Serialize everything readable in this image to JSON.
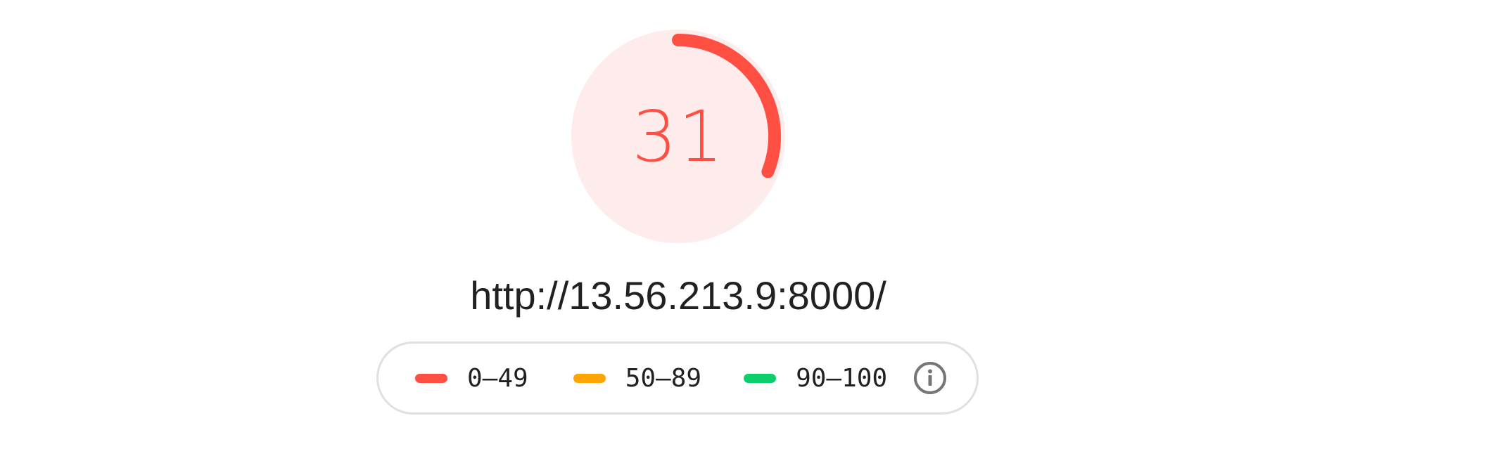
{
  "score": {
    "value": "31",
    "fraction": 0.31,
    "color": "#ff4e42",
    "track_color": "#fdeceb"
  },
  "url": "http://13.56.213.9:8000/",
  "legend": {
    "items": [
      {
        "label": "0–49",
        "color": "#ff4e42"
      },
      {
        "label": "50–89",
        "color": "#ffa400"
      },
      {
        "label": "90–100",
        "color": "#0cce6b"
      }
    ],
    "info_icon": "info-icon"
  }
}
